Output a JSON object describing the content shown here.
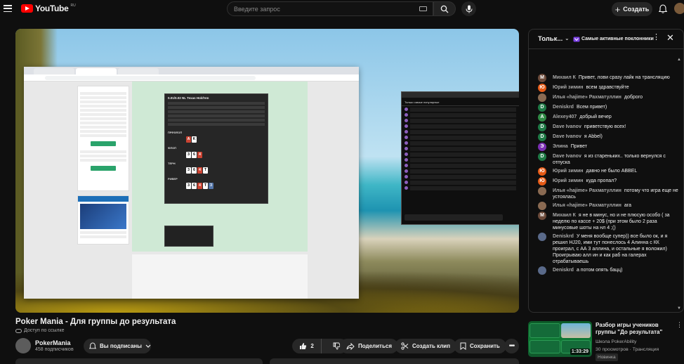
{
  "header": {
    "logo_text": "YouTube",
    "logo_region": "RU",
    "search_placeholder": "Введите запрос",
    "create_label": "Создать"
  },
  "video": {
    "title": "Poker Mania - Для группы до результата",
    "access": "Доступ по ссылке",
    "channel_name": "PokerMania",
    "subscribers": "458 подписчиков",
    "subscribed_label": "Вы подписаны",
    "like_count": "2",
    "share_label": "Поделиться",
    "clip_label": "Создать клип",
    "save_label": "Сохранить",
    "embedded": {
      "poker_header": "0.01/0.02 NL Texas Hold'em",
      "preflop": "ПРЕФЛОП",
      "flop": "ФЛОП",
      "turn": "ТЕРН",
      "river": "РИВЕР",
      "preflop_cards": [
        "A",
        "K"
      ],
      "flop_cards": [
        "3",
        "6",
        "4"
      ],
      "turn_cards": [
        "3",
        "6",
        "4",
        "T"
      ],
      "river_cards": [
        "3",
        "6",
        "4",
        "T",
        "3"
      ],
      "chat_header": "Только самые популярные"
    }
  },
  "chat": {
    "mode_label": "Тольк...",
    "chip_label": "Самые активные поклонники",
    "messages": [
      {
        "initial": "М",
        "color": "#6b4a3a",
        "author": "Михаил К",
        "text": "Привет, лови сразу лайк на трансляцию"
      },
      {
        "initial": "Ю",
        "color": "#e65a16",
        "author": "Юрий зимин",
        "text": "всем здравствуйте"
      },
      {
        "initial": "",
        "color": "#8a6a52",
        "author": "Илья «hajime» Рахматуллин",
        "text": "доброго"
      },
      {
        "initial": "D",
        "color": "#1f7a46",
        "author": "Deniskrd",
        "text": "Всем привет)"
      },
      {
        "initial": "A",
        "color": "#2f8a45",
        "author": "Alexey407",
        "text": "добрый вечер"
      },
      {
        "initial": "D",
        "color": "#1f7a46",
        "author": "Dave Ivanov",
        "text": "приветствую всех!"
      },
      {
        "initial": "D",
        "color": "#1f7a46",
        "author": "Dave Ivanov",
        "text": "я Abbel)"
      },
      {
        "initial": "Э",
        "color": "#7b2fb3",
        "author": "Элина",
        "text": "Привет"
      },
      {
        "initial": "D",
        "color": "#1f7a46",
        "author": "Dave Ivanov",
        "text": "я из стареньких.. только вернулся с отпуска"
      },
      {
        "initial": "Ю",
        "color": "#e65a16",
        "author": "Юрий зимин",
        "text": "давно не было ABBEL"
      },
      {
        "initial": "Ю",
        "color": "#e65a16",
        "author": "Юрий зимин",
        "text": "куда пропал?"
      },
      {
        "initial": "",
        "color": "#8a6a52",
        "author": "Илья «hajime» Рахматуллин",
        "text": "потому что игра еще не устоялась"
      },
      {
        "initial": "",
        "color": "#8a6a52",
        "author": "Илья «hajime» Рахматуллин",
        "text": "ага"
      },
      {
        "initial": "М",
        "color": "#6b4a3a",
        "author": "Михаил К",
        "text": "я не в минус, но и не плюсую особо ( за неделю по кассе + 20$ (при этом было 2 раза минусовые шоты на нл 4 ;()"
      },
      {
        "initial": "",
        "color": "#5a6a8a",
        "author": "Deniskrd",
        "text": "У меня вообще супер)) все было ок, и я решил HJ20, ими тут понеслось 4 Алинна с КК проиграл, с АА 3 аллина, и остальные я воложил) Проигрываю алл ин и как раб на галерах отрабатываешь"
      },
      {
        "initial": "",
        "color": "#5a6a8a",
        "author": "Deniskrd",
        "text": "а потом опять бацц)"
      }
    ]
  },
  "recommendation": {
    "title": "Разбор игры учеников группы \"До результата\"",
    "channel": "Школа PokerAbility",
    "meta": "30 просмотров · Трансляция закончи...",
    "badge": "Новинка",
    "duration": "1:33:29"
  }
}
